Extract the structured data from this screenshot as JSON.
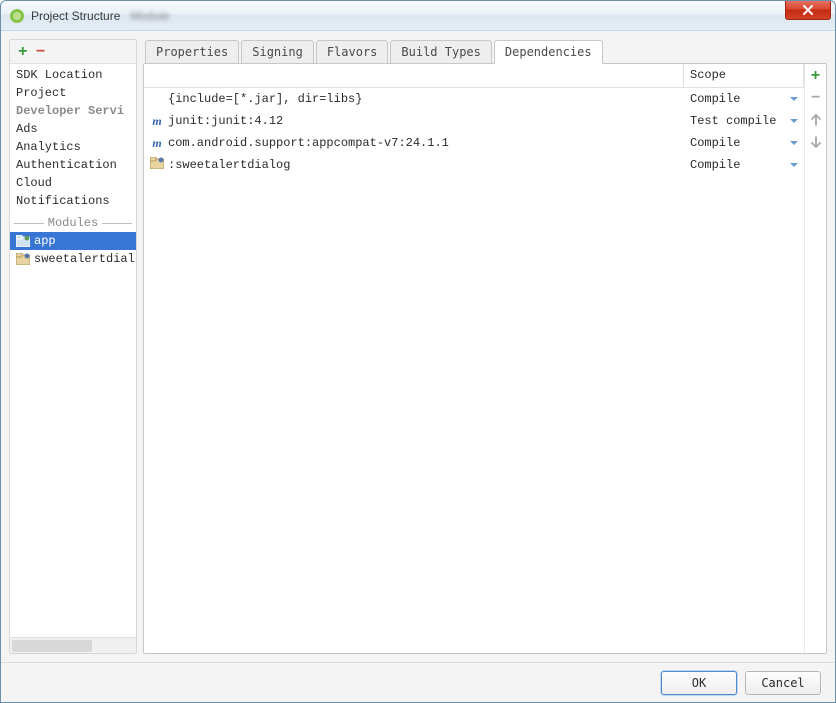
{
  "window": {
    "title": "Project Structure"
  },
  "sidebar": {
    "items": [
      {
        "label": "SDK Location",
        "type": "link"
      },
      {
        "label": "Project",
        "type": "link"
      },
      {
        "label": "Developer Servi",
        "type": "section"
      },
      {
        "label": "Ads",
        "type": "link"
      },
      {
        "label": "Analytics",
        "type": "link"
      },
      {
        "label": "Authentication",
        "type": "link"
      },
      {
        "label": "Cloud",
        "type": "link"
      },
      {
        "label": "Notifications",
        "type": "link"
      }
    ],
    "modules_header": "Modules",
    "modules": [
      {
        "label": "app",
        "selected": true
      },
      {
        "label": "sweetalertdial",
        "selected": false
      }
    ]
  },
  "tabs": [
    {
      "label": "Properties",
      "active": false
    },
    {
      "label": "Signing",
      "active": false
    },
    {
      "label": "Flavors",
      "active": false
    },
    {
      "label": "Build Types",
      "active": false
    },
    {
      "label": "Dependencies",
      "active": true
    }
  ],
  "dep_table": {
    "scope_header": "Scope",
    "rows": [
      {
        "icon": "none",
        "text": "{include=[*.jar], dir=libs}",
        "scope": "Compile"
      },
      {
        "icon": "m",
        "text": "junit:junit:4.12",
        "scope": "Test compile"
      },
      {
        "icon": "m",
        "text": "com.android.support:appcompat-v7:24.1.1",
        "scope": "Compile"
      },
      {
        "icon": "folder",
        "text": ":sweetalertdialog",
        "scope": "Compile"
      }
    ]
  },
  "buttons": {
    "ok": "OK",
    "cancel": "Cancel"
  }
}
